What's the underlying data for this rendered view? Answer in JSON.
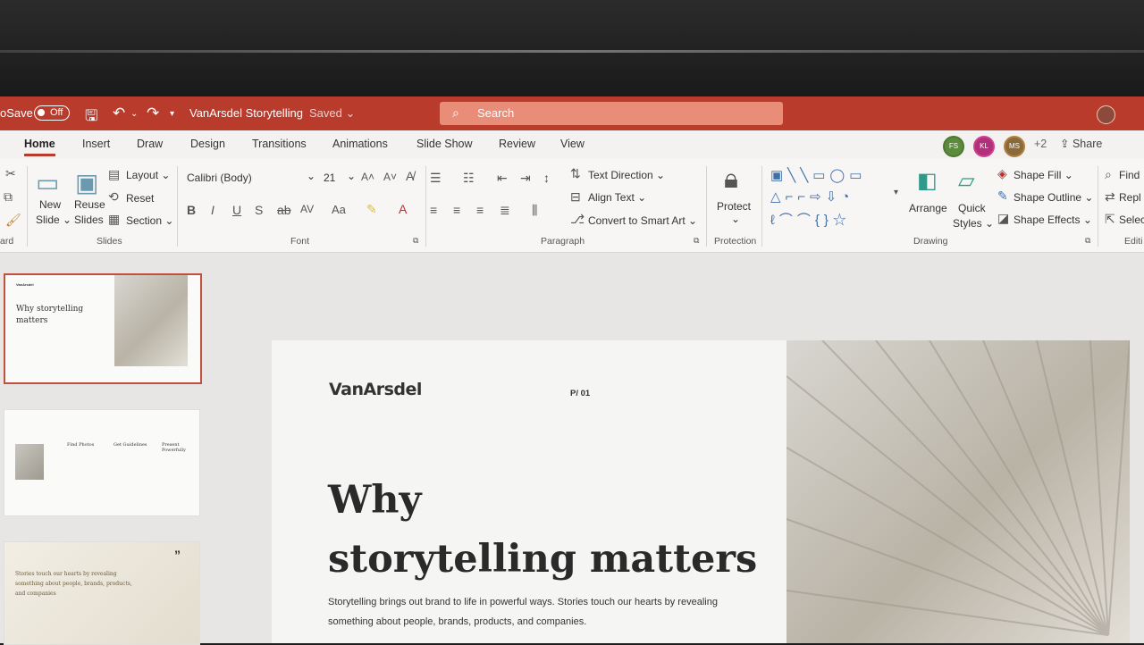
{
  "titlebar": {
    "autosave": "oSave",
    "autosave_state": "Off",
    "doc_title": "VanArsdel Storytelling",
    "doc_status": "Saved ⌄",
    "search_placeholder": "Search"
  },
  "tabs": [
    "Home",
    "Insert",
    "Draw",
    "Design",
    "Transitions",
    "Animations",
    "Slide Show",
    "Review",
    "View"
  ],
  "presence": {
    "users": [
      "FS",
      "KL",
      "MS"
    ],
    "more": "+2",
    "share": "Share"
  },
  "ribbon": {
    "slides": {
      "new_slide": "New Slide ⌄",
      "new_slide_l1": "New",
      "new_slide_l2": "Slide ⌄",
      "reuse_l1": "Reuse",
      "reuse_l2": "Slides",
      "layout": "Layout ⌄",
      "reset": "Reset",
      "section": "Section ⌄",
      "group": "Slides"
    },
    "clipboard_group": "ard",
    "font": {
      "family": "Calibri (Body)",
      "size": "21",
      "group": "Font"
    },
    "paragraph": {
      "text_direction": "Text Direction ⌄",
      "align_text": "Align Text ⌄",
      "convert": "Convert to Smart Art ⌄",
      "group": "Paragraph"
    },
    "protection": {
      "protect": "Protect",
      "group": "Protection"
    },
    "drawing": {
      "arrange": "Arrange",
      "quick_styles_l1": "Quick",
      "quick_styles_l2": "Styles ⌄",
      "shape_fill": "Shape Fill ⌄",
      "shape_outline": "Shape Outline ⌄",
      "shape_effects": "Shape Effects ⌄",
      "group": "Drawing"
    },
    "editing": {
      "find": "Find",
      "replace": "Repl",
      "select": "Selec",
      "group": "Editi"
    }
  },
  "thumbs": {
    "t1": {
      "brand": "VanArsdel",
      "title": "Why storytelling matters"
    },
    "t2": {
      "col1": "Find Photos",
      "col2": "Get Guidelines",
      "col3": "Present Powerfully"
    },
    "t3": {
      "quote": "Stories touch our hearts by revealing something about people, brands, products, and companies"
    }
  },
  "slide": {
    "brand": "VanArsdel",
    "page": "P/ 01",
    "headline_l1": "Why",
    "headline_l2": "storytelling matters",
    "body": "Storytelling brings out brand to life in powerful ways. Stories touch our hearts by revealing something about people, brands, products, and companies."
  },
  "colors": {
    "accent": "#b83b2c",
    "search": "#e98c78"
  }
}
